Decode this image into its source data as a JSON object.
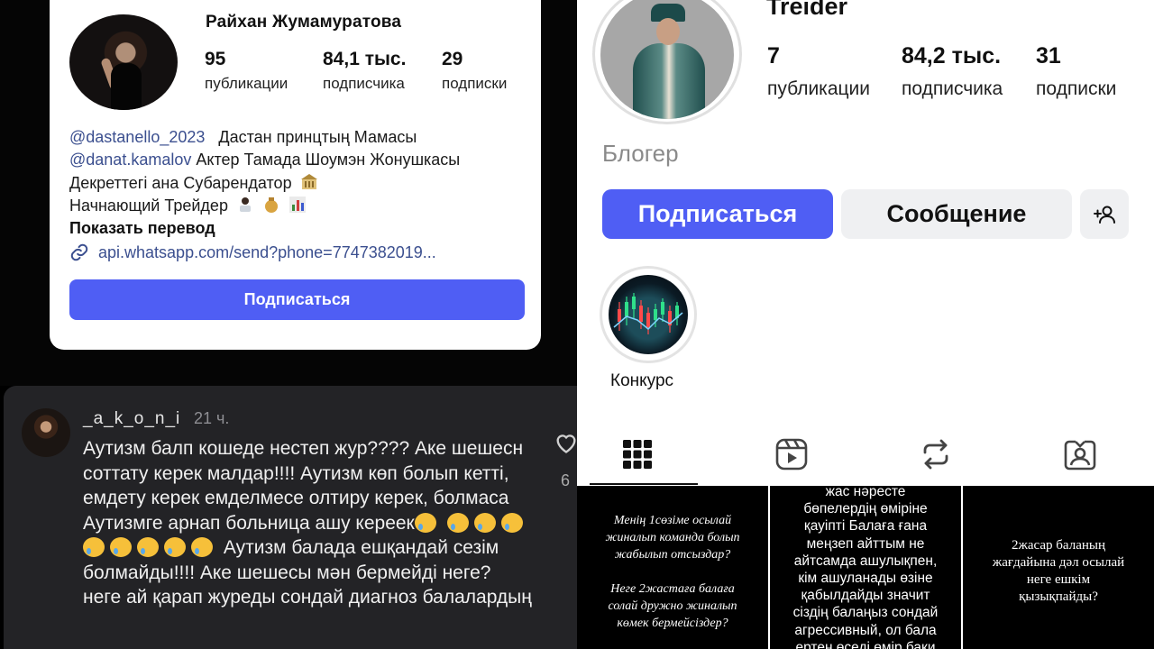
{
  "left_profile": {
    "name": "Райхан Жумамуратова",
    "stats": {
      "posts_count": "95",
      "posts_label": "публикации",
      "followers_count": "84,1 тыс.",
      "followers_label": "подписчика",
      "following_count": "29",
      "following_label": "подписки"
    },
    "bio": {
      "line1_mention": "@dastanello_2023",
      "line1_text": "Дастан принцтың Мамасы",
      "line2_mention": "@danat.kamalov",
      "line2_text": "Актер Тамада Шоумэн Жонушкасы",
      "line3_text": "Декреттегі ана Субарендатор",
      "line4_text": "Начнающий Трейдер",
      "show_translation": "Показать перевод",
      "link": "api.whatsapp.com/send?phone=7747382019..."
    },
    "follow_button": "Подписаться"
  },
  "comment": {
    "username": "_a_k_o_n_i",
    "time": "21 ч.",
    "text_part1": "Аутизм балп кошеде нестеп жур???? Аке шешесн соттату керек малдар!!!! Аутизм көп болып кетті, емдету керек емделмесе олтиру керек, болмаса Аутизмге арнап больница ашу керeек",
    "text_part2": "Аутизм балада ешқандай сезім болмайды!!!! Аке шешесы мән бермейді неге? неге ай қарап журеды сондай диагноз балалардың",
    "likes": "6"
  },
  "right_profile": {
    "name": "Treider",
    "stats": {
      "posts_count": "7",
      "posts_label": "публикации",
      "followers_count": "84,2 тыс.",
      "followers_label": "подписчика",
      "following_count": "31",
      "following_label": "подписки"
    },
    "category": "Блогер",
    "follow_button": "Подписаться",
    "message_button": "Сообщение",
    "highlight_label": "Конкурс"
  },
  "posts": {
    "post1": "Менің 1сөзіме осылай\nжиналып команда болып\nжабылып отсыздар?\n\nНеге 2жастаға балаға\nсолай дружно жиналып\nкөмек бермейсіздер?",
    "post2": "жас нәресте\nбөпелердің өміріне\nқауіпті Балаға ғана\nмеңзеп айттым не\nайтсамда ашулықпен,\nкім ашуланады өзіне\nқабылдайды значит\nсіздің балаңыз сондай\nагрессивный, ол бала\nертең өседі өмір бақи",
    "post3": "2жасар баланың\nжағдайына дәл осылай\nнеге ешкім\nқызықпайды?"
  },
  "colors": {
    "accent_blue": "#4f5ef4",
    "mention_blue": "#3b4f8f",
    "comment_bg": "#232326",
    "secondary_btn": "#eff0f2"
  },
  "icons": {
    "link": "link-icon",
    "heart": "heart-icon",
    "add_user": "add-user-icon",
    "grid": "grid-icon",
    "reels": "reels-icon",
    "reposts": "repost-icon",
    "tagged": "tagged-icon"
  }
}
